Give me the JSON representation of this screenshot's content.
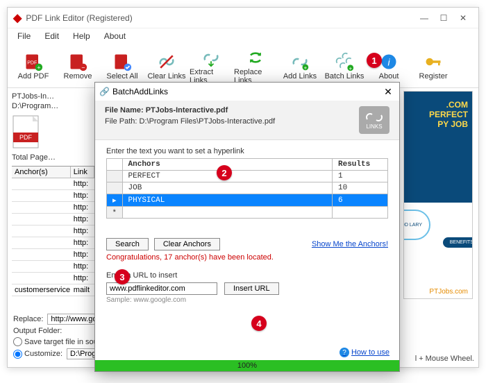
{
  "titlebar": {
    "title": "PDF Link Editor (Registered)"
  },
  "menubar": [
    "File",
    "Edit",
    "Help",
    "About"
  ],
  "toolbar": [
    {
      "id": "add-pdf",
      "label": "Add PDF"
    },
    {
      "id": "remove",
      "label": "Remove"
    },
    {
      "id": "select-all",
      "label": "Select All"
    },
    {
      "id": "clear-links",
      "label": "Clear Links"
    },
    {
      "id": "extract-links",
      "label": "Extract Links"
    },
    {
      "id": "replace-links",
      "label": "Replace Links"
    },
    {
      "id": "add-links",
      "label": "Add Links"
    },
    {
      "id": "batch-links",
      "label": "Batch Links"
    },
    {
      "id": "about",
      "label": "About"
    },
    {
      "id": "register",
      "label": "Register"
    }
  ],
  "callouts": {
    "1": "1",
    "2": "2",
    "3": "3",
    "4": "4"
  },
  "file": {
    "name_short": "PTJobs-In…",
    "path_short": "D:\\Program…",
    "pages": "Total Page…"
  },
  "anchor_header": {
    "a": "Anchor(s)",
    "b": "Link"
  },
  "anchor_rows": [
    {
      "a": "",
      "b": "http:"
    },
    {
      "a": "",
      "b": "http:"
    },
    {
      "a": "",
      "b": "http:"
    },
    {
      "a": "",
      "b": "http:"
    },
    {
      "a": "",
      "b": "http:"
    },
    {
      "a": "",
      "b": "http:"
    },
    {
      "a": "",
      "b": "http:"
    },
    {
      "a": "",
      "b": "http:"
    },
    {
      "a": "",
      "b": "http:"
    },
    {
      "a": "customerservice@…",
      "b": "mailt"
    }
  ],
  "bottom": {
    "replace_label": "Replace:",
    "replace_value": "http://www.goo",
    "output_label": "Output Folder:",
    "save_same": "Save target file in sourc",
    "customize": "Customize:",
    "customize_value": "D:\\Program",
    "mouse_hint": "l + Mouse Wheel."
  },
  "preview": {
    "line1": ".COM",
    "line2": "PERFECT",
    "line3": "PY JOB",
    "circle": "OOD LARY",
    "benefits": "BENEFITS",
    "brand": "PTJobs.com"
  },
  "dialog": {
    "title": "BatchAddLinks",
    "file_name_label": "File Name: ",
    "file_name": "PTJobs-Interactive.pdf",
    "file_path_label": "File Path: ",
    "file_path": "D:\\Program Files\\PTJobs-Interactive.pdf",
    "links_badge": "LINKS",
    "prompt": "Enter the text you want to set a hyperlink",
    "cols": {
      "anchors": "Anchors",
      "results": "Results"
    },
    "rows": [
      {
        "a": "PERFECT",
        "r": "1",
        "sel": false
      },
      {
        "a": "JOB",
        "r": "10",
        "sel": false
      },
      {
        "a": "PHYSICAL",
        "r": "6",
        "sel": true
      }
    ],
    "newrow": "*",
    "search": "Search",
    "clear": "Clear Anchors",
    "showme": "Show Me the Anchors!",
    "status": "Congratulations, 17 anchor(s) have been located.",
    "url_label": "Enter a URL to insert",
    "url_value": "www.pdflinkeditor.com",
    "insert": "Insert URL",
    "sample": "Sample: www.google.com",
    "howto": "How to use",
    "progress": "100%"
  }
}
